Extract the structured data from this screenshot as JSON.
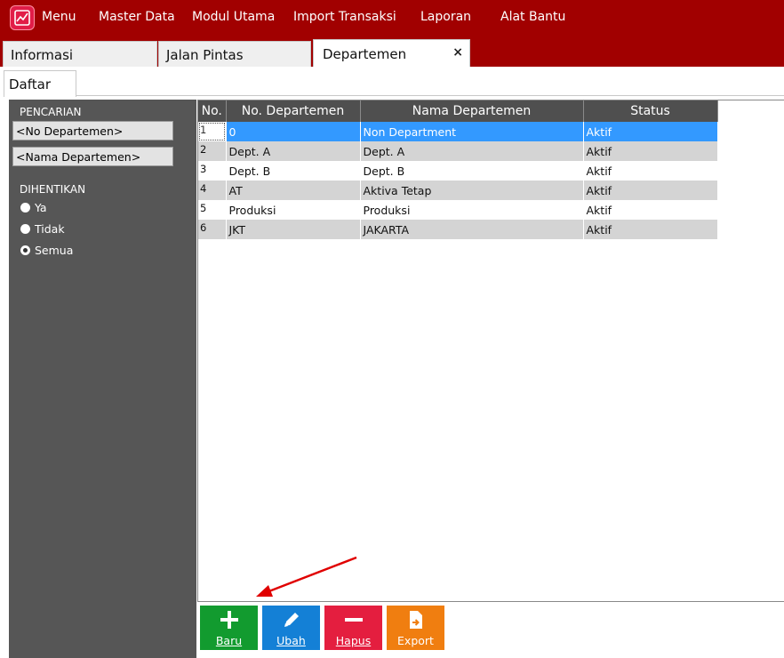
{
  "app": {
    "menu": [
      "Menu",
      "Master Data",
      "Modul Utama",
      "Import Transaksi",
      "Laporan",
      "Alat Bantu"
    ],
    "logo_icon": "chart-logo-icon",
    "accent_color": "#a10000"
  },
  "tabs": {
    "items": [
      "Informasi",
      "Jalan Pintas",
      "Departemen"
    ],
    "active": "Departemen",
    "close": "×"
  },
  "subtab": {
    "label": "Daftar"
  },
  "search": {
    "section_label": "PENCARIAN",
    "no_departemen": "<No Departemen>",
    "nama_departemen": "<Nama Departemen>",
    "stopped_label": "DIHENTIKAN",
    "options": [
      "Ya",
      "Tidak",
      "Semua"
    ],
    "selected": "Semua"
  },
  "grid": {
    "columns": [
      "No.",
      "No. Departemen",
      "Nama Departemen",
      "Status"
    ],
    "rows": [
      [
        "1",
        "0",
        "Non Department",
        "Aktif"
      ],
      [
        "2",
        "Dept. A",
        "Dept. A",
        "Aktif"
      ],
      [
        "3",
        "Dept. B",
        "Dept. B",
        "Aktif"
      ],
      [
        "4",
        "AT",
        "Aktiva Tetap",
        "Aktif"
      ],
      [
        "5",
        "Produksi",
        "Produksi",
        "Aktif"
      ],
      [
        "6",
        "JKT",
        "JAKARTA",
        "Aktif"
      ]
    ],
    "selected_row": 1
  },
  "toolbar": {
    "baru": "Baru",
    "ubah": "Ubah",
    "hapus": "Hapus",
    "export": "Export",
    "colors": {
      "baru": "#129b2f",
      "ubah": "#1480d6",
      "hapus": "#e41e3f",
      "export": "#f07e10"
    }
  }
}
